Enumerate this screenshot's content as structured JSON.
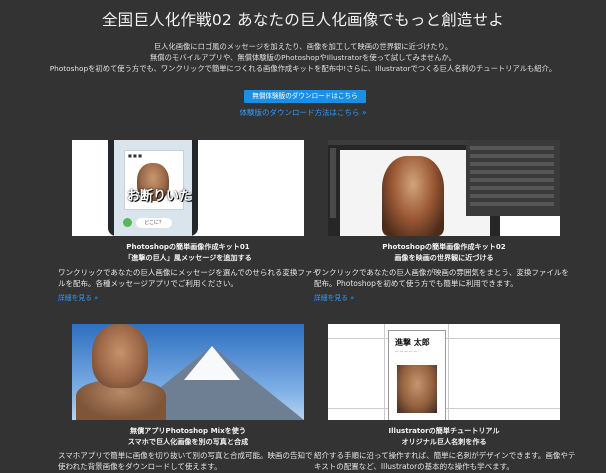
{
  "header": {
    "title": "全国巨人化作戦02 あなたの巨人化画像でもっと創造せよ",
    "intro": [
      "巨人化画像にロゴ風のメッセージを加えたり、画像を加工して映画の世界観に近づけたり。",
      "無償のモバイルアプリや、無償体験版のPhotoshopやIllustratorを使って試してみませんか。",
      "Photoshopを初めて使う方でも、ワンクリックで簡単につくれる画像作成キットを配布中!さらに、Illustratorでつくる巨人名刺のチュートリアルも紹介。"
    ],
    "cta_label": "無償体験版のダウンロードはこちら",
    "howto_link": "体験版のダウンロード方法はこちら »"
  },
  "cards": [
    {
      "title_line1": "Photoshopの簡単画像作成キット01",
      "title_line2": "「進撃の巨人」風メッセージを追加する",
      "desc": "ワンクリックであなたの巨人画像にメッセージを選んでのせられる変換ファイルを配布。各種メッセージアプリでご利用ください。",
      "link": "詳細を見る »",
      "thumb_stamp_text": "お断りいた",
      "thumb_bubble_text": "どこに？"
    },
    {
      "title_line1": "Photoshopの簡単画像作成キット02",
      "title_line2": "画像を映画の世界観に近づける",
      "desc": "ワンクリックであなたの巨人画像が映画の雰囲気をまとう、変換ファイルを配布。Photoshopを初めて使う方でも簡単に利用できます。",
      "link": "詳細を見る »"
    },
    {
      "title_line1": "無償アプリPhotoshop Mixを使う",
      "title_line2": "スマホで巨人化画像を別の写真と合成",
      "desc": "スマホアプリで簡単に画像を切り抜いて別の写真と合成可能。映画の告知で使われた背景画像をダウンロードして使えます。"
    },
    {
      "title_line1": "Illustratorの簡単チュートリアル",
      "title_line2": "オリジナル巨人名刺を作る",
      "desc": "紹介する手順に沿って操作すれば、簡単に名刺がデザインできます。画像やテキストの配置など、Illustratorの基本的な操作も学べます。",
      "biz_name": "進撃 太郎"
    }
  ]
}
